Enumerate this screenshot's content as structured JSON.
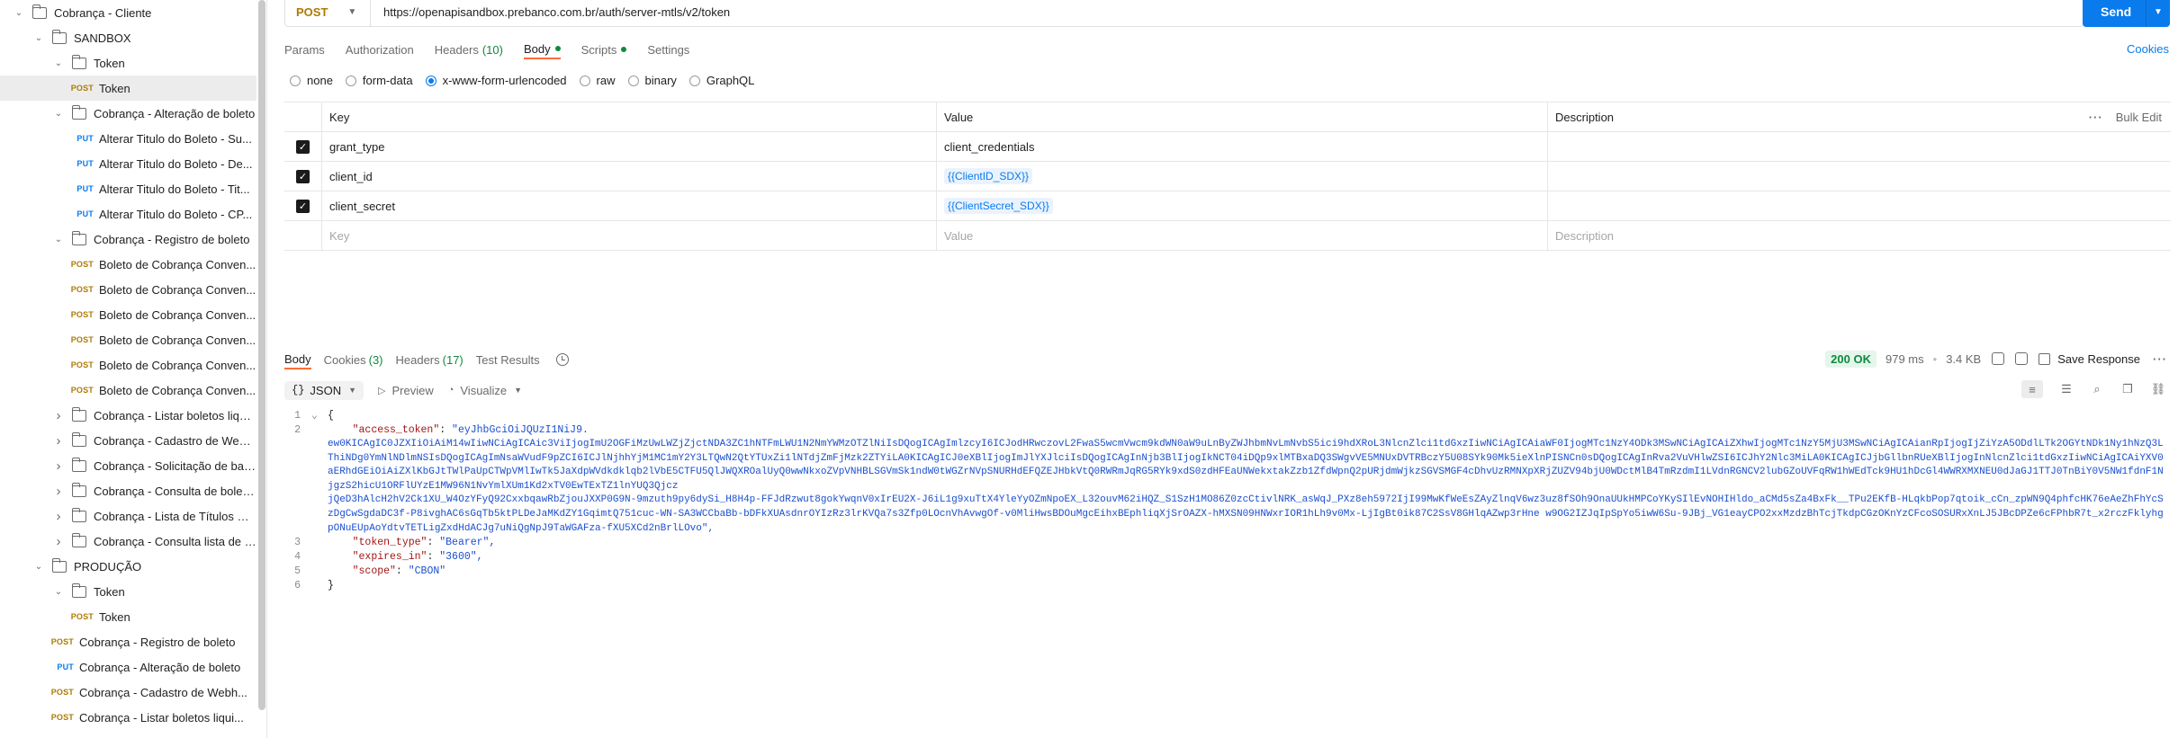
{
  "sidebar": {
    "items": [
      {
        "indent": 1,
        "type": "folder",
        "chevron": "down",
        "label": "Cobrança - Cliente"
      },
      {
        "indent": 2,
        "type": "folder",
        "chevron": "down",
        "label": "SANDBOX"
      },
      {
        "indent": 3,
        "type": "folder",
        "chevron": "down",
        "label": "Token"
      },
      {
        "indent": 4,
        "type": "request",
        "method": "POST",
        "label": "Token",
        "active": true
      },
      {
        "indent": 3,
        "type": "folder",
        "chevron": "down",
        "label": "Cobrança - Alteração de boleto"
      },
      {
        "indent": 4,
        "type": "request",
        "method": "PUT",
        "label": "Alterar Titulo do Boleto - Su..."
      },
      {
        "indent": 4,
        "type": "request",
        "method": "PUT",
        "label": "Alterar Titulo do Boleto - De..."
      },
      {
        "indent": 4,
        "type": "request",
        "method": "PUT",
        "label": "Alterar Titulo do Boleto - Tit..."
      },
      {
        "indent": 4,
        "type": "request",
        "method": "PUT",
        "label": "Alterar Titulo do Boleto - CP..."
      },
      {
        "indent": 3,
        "type": "folder",
        "chevron": "down",
        "label": "Cobrança - Registro de boleto"
      },
      {
        "indent": 4,
        "type": "request",
        "method": "POST",
        "label": "Boleto de Cobrança Conven..."
      },
      {
        "indent": 4,
        "type": "request",
        "method": "POST",
        "label": "Boleto de Cobrança Conven..."
      },
      {
        "indent": 4,
        "type": "request",
        "method": "POST",
        "label": "Boleto de Cobrança Conven..."
      },
      {
        "indent": 4,
        "type": "request",
        "method": "POST",
        "label": "Boleto de Cobrança Conven..."
      },
      {
        "indent": 4,
        "type": "request",
        "method": "POST",
        "label": "Boleto de Cobrança Conven..."
      },
      {
        "indent": 4,
        "type": "request",
        "method": "POST",
        "label": "Boleto de Cobrança Conven..."
      },
      {
        "indent": 3,
        "type": "folder",
        "chevron": "right",
        "label": "Cobrança - Listar boletos liqui..."
      },
      {
        "indent": 3,
        "type": "folder",
        "chevron": "right",
        "label": "Cobrança - Cadastro de Webh..."
      },
      {
        "indent": 3,
        "type": "folder",
        "chevron": "right",
        "label": "Cobrança - Solicitação de baix..."
      },
      {
        "indent": 3,
        "type": "folder",
        "chevron": "right",
        "label": "Cobrança - Consulta de boleto..."
      },
      {
        "indent": 3,
        "type": "folder",
        "chevron": "right",
        "label": "Cobrança - Lista de Títulos Bai..."
      },
      {
        "indent": 3,
        "type": "folder",
        "chevron": "right",
        "label": "Cobrança - Consulta lista de b..."
      },
      {
        "indent": 2,
        "type": "folder",
        "chevron": "down",
        "label": "PRODUÇÃO"
      },
      {
        "indent": 3,
        "type": "folder",
        "chevron": "down",
        "label": "Token"
      },
      {
        "indent": 4,
        "type": "request",
        "method": "POST",
        "label": "Token"
      },
      {
        "indent": 3,
        "type": "request",
        "method": "POST",
        "label": "Cobrança - Registro de boleto"
      },
      {
        "indent": 3,
        "type": "request",
        "method": "PUT",
        "label": "Cobrança - Alteração de boleto"
      },
      {
        "indent": 3,
        "type": "request",
        "method": "POST",
        "label": "Cobrança - Cadastro de Webh..."
      },
      {
        "indent": 3,
        "type": "request",
        "method": "POST",
        "label": "Cobrança - Listar boletos liqui..."
      }
    ]
  },
  "request": {
    "method": "POST",
    "url": "https://openapisandbox.prebanco.com.br/auth/server-mtls/v2/token",
    "send_label": "Send"
  },
  "tabs": {
    "params": "Params",
    "authorization": "Authorization",
    "headers": "Headers",
    "headers_count": "(10)",
    "body": "Body",
    "scripts": "Scripts",
    "settings": "Settings",
    "cookies": "Cookies"
  },
  "body_types": [
    "none",
    "form-data",
    "x-www-form-urlencoded",
    "raw",
    "binary",
    "GraphQL"
  ],
  "body_type_selected": "x-www-form-urlencoded",
  "kv": {
    "headers": {
      "key": "Key",
      "value": "Value",
      "description": "Description",
      "bulk_edit": "Bulk Edit"
    },
    "rows": [
      {
        "key": "grant_type",
        "value": "client_credentials",
        "is_var": false
      },
      {
        "key": "client_id",
        "value": "{{ClientID_SDX}}",
        "is_var": true
      },
      {
        "key": "client_secret",
        "value": "{{ClientSecret_SDX}}",
        "is_var": true
      }
    ],
    "placeholder": {
      "key": "Key",
      "value": "Value",
      "description": "Description"
    }
  },
  "response": {
    "tabs": {
      "body": "Body",
      "cookies": "Cookies",
      "cookies_count": "(3)",
      "headers": "Headers",
      "headers_count": "(17)",
      "test_results": "Test Results"
    },
    "status": "200 OK",
    "time": "979 ms",
    "size": "3.4 KB",
    "save_label": "Save Response",
    "format": "JSON",
    "preview": "Preview",
    "visualize": "Visualize",
    "lines": {
      "l1": "{",
      "l2_key": "\"access_token\"",
      "l2_val_start": "\"eyJhbGciOiJQUzI1NiJ9.",
      "token_body": "ew0KICAgIC0JZXIiOiAiM14wIiwNCiAgICAic3ViIjogImU2OGFiMzUwLWZjZjctNDA3ZC1hNTFmLWU1N2NmYWMzOTZlNiIsDQogICAgImlzcyI6ICJodHRwczovL2FwaS5wcmVwcm9kdWN0aW9uLnByZWJhbmNvLmNvbS5ici9hdXRoL3NlcnZlci1tdGxzIiwNCiAgICAiaWF0IjogMTc1NzY4ODk3MSwNCiAgICAiZXhwIjogMTc1NzY5MjU3MSwNCiAgICAianRpIjogIjZiYzA5ODdlLTk2OGYtNDk1Ny1hNzQ3LThiNDg0YmNlNDlmNSIsDQogICAgImNsaWVudF9pZCI6ICJlNjhhYjM1MC1mY2Y3LTQwN2QtYTUxZi1lNTdjZmFjMzk2ZTYiLA0KICAgICJ0eXBlIjogImJlYXJlciIsDQogICAgInNjb3BlIjogIkNCT04iDQp9xlMTBxaDQ3SWgvVE5MNUxDVTRBczY5U08SYk90Mk5ieXlnPISNCn0sDQogICAgInRva2VuVHlwZSI6ICJhY2Nlc3MiLA0KICAgICJjbGllbnRUeXBlIjogInNlcnZlci1tdGxzIiwNCiAgICAiYXV0aERhdGEiOiAiZXlKbGJtTWlPaUpCTWpVMlIwTk5JaXdpWVdkdklqb2lVbE5CTFU5QlJWQXROalUyQ0wwNkxoZVpVNHBLSGVmSk1ndW0tWGZrNVpSNURHdEFQZEJHbkVtQ0RWRmJqRG5RYk9xdS0zdHFEaUNWekxtakZzb1ZfdWpnQ2pURjdmWjkzSGVSMGF4cDhvUzRMNXpXRjZUZV94bjU0WDctMlB4TmRzdmI1LVdnRGNCV2lubGZoUVFqRW1hWEdTck9HU1hDcGl4WWRXMXNEU0dJaGJ1TTJ0TnBiY0V5NW1fdnF1NjgzS2hicU1ORFlUYzE1MW96N1NvYmlXUm1Kd2xTV0EwTExTZ1lnYUQ3Qjcz",
      "token_tail": "jQeD3hAlcH2hV2Ck1XU_W4OzYFyQ92CxxbqawRbZjouJXXP0G9N-9mzuth9py6dySi_H8H4p-FFJdRzwut8gokYwqnV0xIrEU2X-J6iL1g9xuTtX4YleYyOZmNpoEX_L32ouvM62iHQZ_S1SzH1MO86Z0zcCtivlNRK_asWqJ_PXz8eh5972IjI99MwKfWeEsZAyZlnqV6wz3uz8fSOh9OnaUUkHMPCoYKySIlEvNOHIHldo_aCMd5sZa4BxFk__TPu2EKfB-HLqkbPop7qtoik_cCn_zpWN9Q4phfcHK76eAeZhFhYcSzDgCwSgdaDC3f-P8ivghAC6sGqTb5ktPLDeJaMKdZY1GqimtQ751cuc-WN-SA3WCCbaBb-bDFkXUAsdnrOYIzRz3lrKVQa7s3Zfp0LOcnVhAvwgOf-v0MliHwsBDOuMgcEihxBEphliqXjSrOAZX-hMXSN09HNWxrIOR1hLh9v0Mx-LjIgBt0ik87C2SsV8GHlqAZwp3rHne w9OG2IZJqIpSpYo5iwW6Su-9JBj_VG1eayCPO2xxMzdzBhTcjTkdpCGzOKnYzCFcoSOSURxXnLJ5JBcDPZe6cFPhbR7t_x2rczFklyhgpONuEUpAoYdtvTETLigZxdHdACJg7uNiQgNpJ9TaWGAFza-fXU5XCd2nBrlLOvo\",",
      "l3_key": "\"token_type\"",
      "l3_val": "\"Bearer\",",
      "l4_key": "\"expires_in\"",
      "l4_val": "\"3600\",",
      "l5_key": "\"scope\"",
      "l5_val": "\"CBON\"",
      "l6": "}"
    }
  },
  "colors": {
    "accent": "#097bed",
    "post": "#ad7a03",
    "put": "#097bed",
    "status_ok": "#0f8a3d",
    "active_tab_underline": "#ff6c37"
  }
}
